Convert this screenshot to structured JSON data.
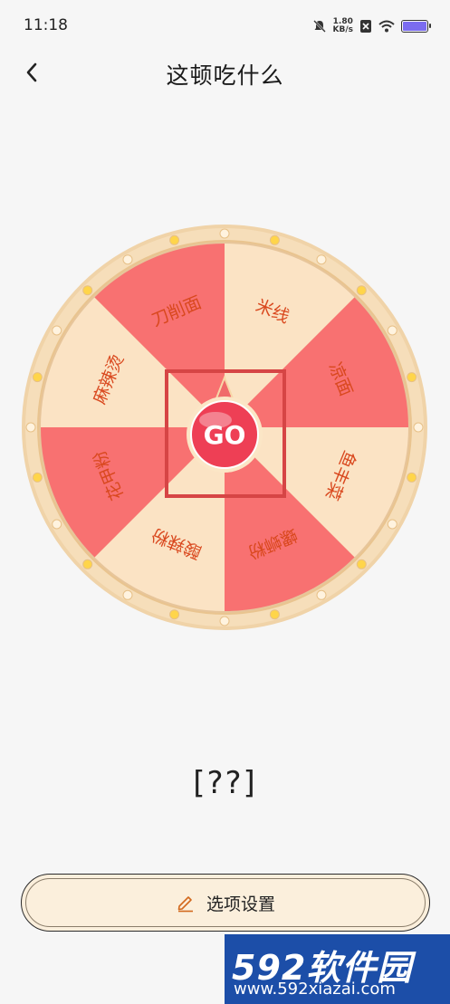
{
  "status_bar": {
    "time": "11:18",
    "speed_value": "1.80",
    "speed_unit": "KB/s",
    "battery_color": "#7b6cf0"
  },
  "header": {
    "title": "这顿吃什么",
    "back_icon": "chevron-left-icon"
  },
  "wheel": {
    "segments": [
      {
        "label": "米线",
        "color": "#fbe3c4"
      },
      {
        "label": "凉面",
        "color": "#f87171"
      },
      {
        "label": "鱼丰菜",
        "color": "#fbe3c4"
      },
      {
        "label": "螺蛳粉",
        "color": "#f87171"
      },
      {
        "label": "酸辣粉",
        "color": "#fbe3c4"
      },
      {
        "label": "花甲粉",
        "color": "#f87171"
      },
      {
        "label": "麻辣烫",
        "color": "#fbe3c4"
      },
      {
        "label": "刀削面",
        "color": "#f87171"
      }
    ],
    "go_label": "GO",
    "label_color": "#d9481e",
    "rim_color": "#f6deba"
  },
  "result": {
    "text": "[??]"
  },
  "settings_button": {
    "label": "选项设置",
    "icon": "pencil-icon"
  },
  "watermark": {
    "brand_num": "592",
    "brand_text": "软件园",
    "url": "www.592xiazai.com"
  }
}
